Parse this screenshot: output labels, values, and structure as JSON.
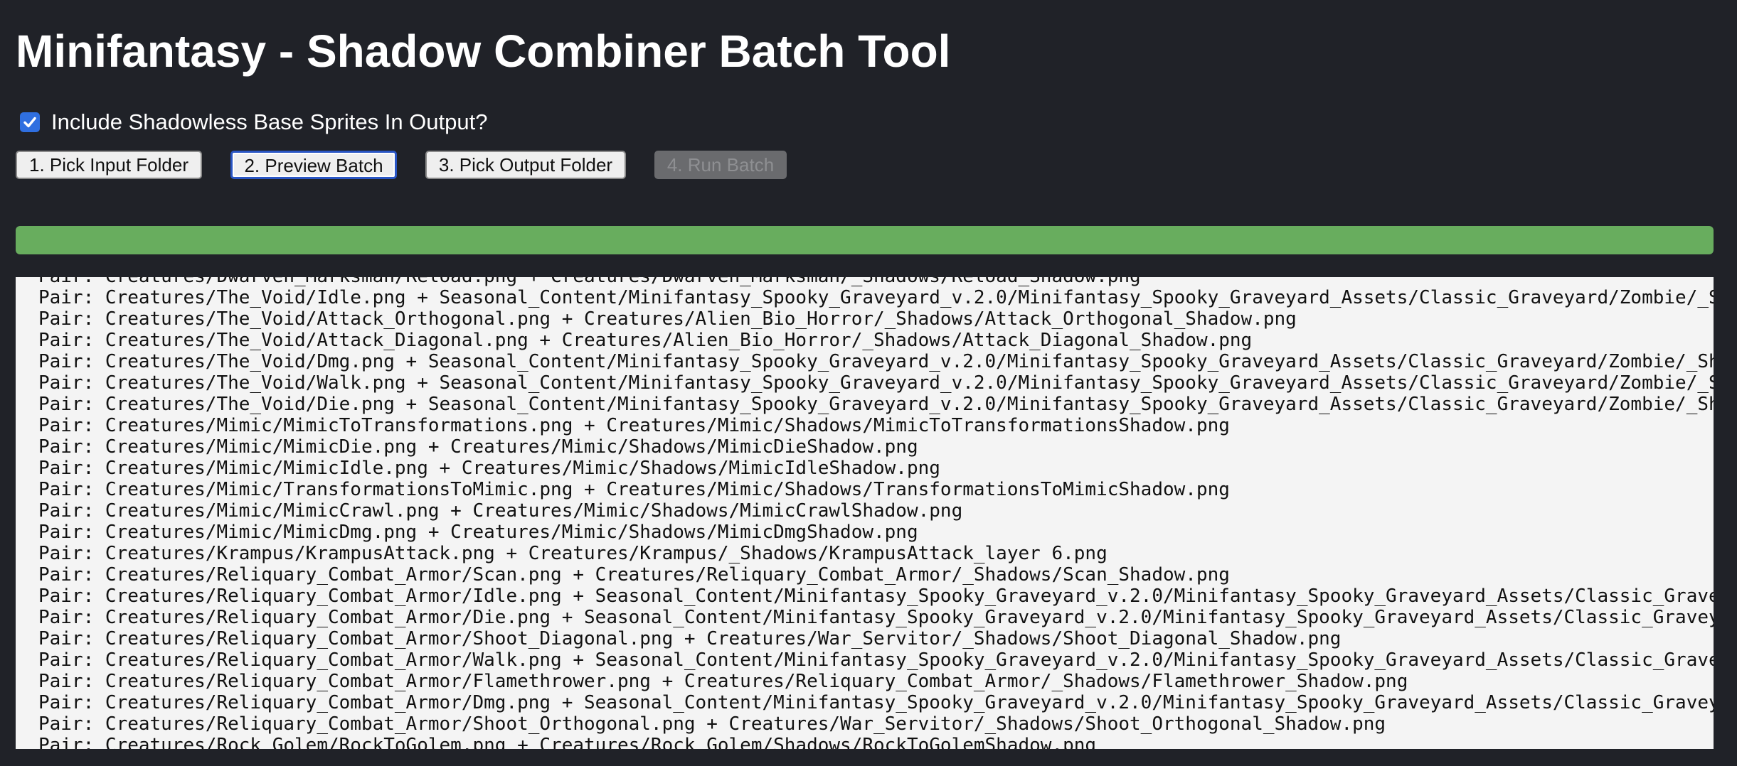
{
  "app": {
    "title": "Minifantasy - Shadow Combiner Batch Tool"
  },
  "options": {
    "include_shadowless_label": "Include Shadowless Base Sprites In Output?",
    "include_shadowless_checked": true
  },
  "buttons": {
    "pick_input": "1. Pick Input Folder",
    "preview_batch": "2. Preview Batch",
    "pick_output": "3. Pick Output Folder",
    "run_batch": "4. Run Batch"
  },
  "progress": {
    "fraction": 1.0,
    "color": "#68ad5e"
  },
  "log": {
    "lines": [
      "Pair: Creatures/Dwarven_Marksman/Reload.png + Creatures/Dwarven_Marksman/_Shadows/Reload_Shadow.png",
      "Pair: Creatures/The_Void/Idle.png + Seasonal_Content/Minifantasy_Spooky_Graveyard_v.2.0/Minifantasy_Spooky_Graveyard_Assets/Classic_Graveyard/Zombie/_Sh",
      "Pair: Creatures/The_Void/Attack_Orthogonal.png + Creatures/Alien_Bio_Horror/_Shadows/Attack_Orthogonal_Shadow.png",
      "Pair: Creatures/The_Void/Attack_Diagonal.png + Creatures/Alien_Bio_Horror/_Shadows/Attack_Diagonal_Shadow.png",
      "Pair: Creatures/The_Void/Dmg.png + Seasonal_Content/Minifantasy_Spooky_Graveyard_v.2.0/Minifantasy_Spooky_Graveyard_Assets/Classic_Graveyard/Zombie/_Sh",
      "Pair: Creatures/The_Void/Walk.png + Seasonal_Content/Minifantasy_Spooky_Graveyard_v.2.0/Minifantasy_Spooky_Graveyard_Assets/Classic_Graveyard/Zombie/_S",
      "Pair: Creatures/The_Void/Die.png + Seasonal_Content/Minifantasy_Spooky_Graveyard_v.2.0/Minifantasy_Spooky_Graveyard_Assets/Classic_Graveyard/Zombie/_Sh",
      "Pair: Creatures/Mimic/MimicToTransformations.png + Creatures/Mimic/Shadows/MimicToTransformationsShadow.png",
      "Pair: Creatures/Mimic/MimicDie.png + Creatures/Mimic/Shadows/MimicDieShadow.png",
      "Pair: Creatures/Mimic/MimicIdle.png + Creatures/Mimic/Shadows/MimicIdleShadow.png",
      "Pair: Creatures/Mimic/TransformationsToMimic.png + Creatures/Mimic/Shadows/TransformationsToMimicShadow.png",
      "Pair: Creatures/Mimic/MimicCrawl.png + Creatures/Mimic/Shadows/MimicCrawlShadow.png",
      "Pair: Creatures/Mimic/MimicDmg.png + Creatures/Mimic/Shadows/MimicDmgShadow.png",
      "Pair: Creatures/Krampus/KrampusAttack.png + Creatures/Krampus/_Shadows/KrampusAttack_layer 6.png",
      "Pair: Creatures/Reliquary_Combat_Armor/Scan.png + Creatures/Reliquary_Combat_Armor/_Shadows/Scan_Shadow.png",
      "Pair: Creatures/Reliquary_Combat_Armor/Idle.png + Seasonal_Content/Minifantasy_Spooky_Graveyard_v.2.0/Minifantasy_Spooky_Graveyard_Assets/Classic_Grave",
      "Pair: Creatures/Reliquary_Combat_Armor/Die.png + Seasonal_Content/Minifantasy_Spooky_Graveyard_v.2.0/Minifantasy_Spooky_Graveyard_Assets/Classic_Gravey",
      "Pair: Creatures/Reliquary_Combat_Armor/Shoot_Diagonal.png + Creatures/War_Servitor/_Shadows/Shoot_Diagonal_Shadow.png",
      "Pair: Creatures/Reliquary_Combat_Armor/Walk.png + Seasonal_Content/Minifantasy_Spooky_Graveyard_v.2.0/Minifantasy_Spooky_Graveyard_Assets/Classic_Grave",
      "Pair: Creatures/Reliquary_Combat_Armor/Flamethrower.png + Creatures/Reliquary_Combat_Armor/_Shadows/Flamethrower_Shadow.png",
      "Pair: Creatures/Reliquary_Combat_Armor/Dmg.png + Seasonal_Content/Minifantasy_Spooky_Graveyard_v.2.0/Minifantasy_Spooky_Graveyard_Assets/Classic_Gravey",
      "Pair: Creatures/Reliquary_Combat_Armor/Shoot_Orthogonal.png + Creatures/War_Servitor/_Shadows/Shoot_Orthogonal_Shadow.png",
      "Pair: Creatures/Rock_Golem/RockToGolem.png + Creatures/Rock_Golem/Shadows/RockToGolemShadow.png"
    ]
  }
}
